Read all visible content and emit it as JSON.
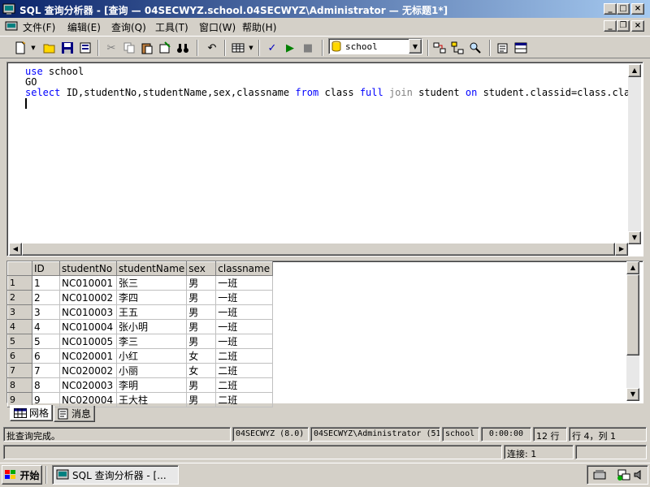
{
  "window": {
    "title": "SQL 查询分析器 - [查询 — 04SECWYZ.school.04SECWYZ\\Administrator — 无标题1*]"
  },
  "menu": {
    "items": [
      "文件(F)",
      "编辑(E)",
      "查询(Q)",
      "工具(T)",
      "窗口(W)",
      "帮助(H)"
    ]
  },
  "toolbar": {
    "database": "school"
  },
  "editor": {
    "line1_kw": "use",
    "line1_rest": " school",
    "line2": "GO",
    "line3_select": "select",
    "line3_cols": " ID,studentNo,studentName,sex,classname ",
    "line3_from": "from",
    "line3_class": " class ",
    "line3_full": "full",
    "line3_join": " join",
    "line3_student": " student ",
    "line3_on": "on",
    "line3_cond": " student.classid=class.classi"
  },
  "results": {
    "columns": [
      "ID",
      "studentNo",
      "studentName",
      "sex",
      "classname"
    ],
    "rows": [
      [
        "1",
        "1",
        "NC010001",
        "张三",
        "男",
        "一班"
      ],
      [
        "2",
        "2",
        "NC010002",
        "李四",
        "男",
        "一班"
      ],
      [
        "3",
        "3",
        "NC010003",
        "王五",
        "男",
        "一班"
      ],
      [
        "4",
        "4",
        "NC010004",
        "张小明",
        "男",
        "一班"
      ],
      [
        "5",
        "5",
        "NC010005",
        "李三",
        "男",
        "一班"
      ],
      [
        "6",
        "6",
        "NC020001",
        "小红",
        "女",
        "二班"
      ],
      [
        "7",
        "7",
        "NC020002",
        "小丽",
        "女",
        "二班"
      ],
      [
        "8",
        "8",
        "NC020003",
        "李明",
        "男",
        "二班"
      ],
      [
        "9",
        "9",
        "NC020004",
        "王大柱",
        "男",
        "二班"
      ]
    ]
  },
  "tabs": {
    "grid": "网格",
    "messages": "消息"
  },
  "status": {
    "message": "批查询完成。",
    "server": "04SECWYZ (8.0)",
    "user": "04SECWYZ\\Administrator (51",
    "db": "school",
    "time": "0:00:00",
    "rows": "12 行",
    "position": "行 4，列 1",
    "connections": "连接: 1"
  },
  "taskbar": {
    "start": "开始",
    "task": "SQL 查询分析器 - [..."
  }
}
